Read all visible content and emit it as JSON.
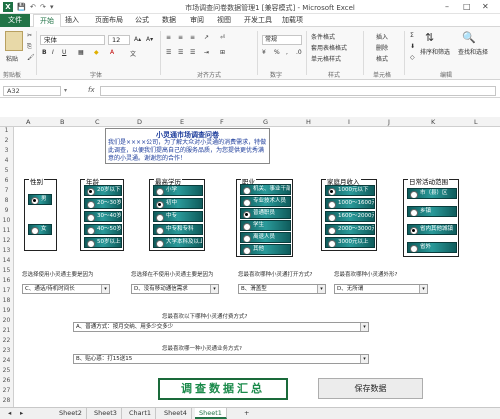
{
  "window": {
    "title": "市场调查问卷数据管理1 [兼容模式] - Microsoft Excel",
    "min": "–",
    "max": "□",
    "close": "✕"
  },
  "ribbon_tabs": [
    "文件",
    "开始",
    "插入",
    "页面布局",
    "公式",
    "数据",
    "审阅",
    "视图",
    "开发工具",
    "加载项"
  ],
  "ribbon": {
    "paste": "粘贴",
    "font_name": "宋体",
    "font_size": "12",
    "number_format": "常规",
    "bold": "B",
    "italic": "I",
    "underline": "U",
    "cond_format": "条件格式",
    "table_format": "套用表格格式",
    "cell_style": "单元格样式",
    "insert": "插入",
    "delete": "删除",
    "format": "格式",
    "sort_filter": "排序和筛选",
    "find_select": "查找和选择",
    "groups": [
      "剪贴板",
      "字体",
      "对齐方式",
      "数字",
      "样式",
      "单元格",
      "编辑"
    ]
  },
  "formula_bar": {
    "name_box": "A32",
    "fx": "fx",
    "value": ""
  },
  "columns": [
    "A",
    "B",
    "C",
    "D",
    "E",
    "F",
    "G",
    "H",
    "I",
    "J",
    "K",
    "L"
  ],
  "rows": [
    "1",
    "2",
    "3",
    "4",
    "5",
    "6",
    "7",
    "8",
    "9",
    "10",
    "11",
    "12",
    "13",
    "14",
    "15",
    "16",
    "17",
    "18",
    "19",
    "20",
    "21",
    "22",
    "23",
    "24",
    "25",
    "26",
    "27",
    "28",
    "29",
    "30",
    "31",
    "32"
  ],
  "survey": {
    "title": "小灵通市场调查问卷",
    "intro": "我们是××××公司，为了解大众对小灵通的消费需求，特做此调查，以便我们提高自己的服务品质，为您提供更优秀满意的小灵通。谢谢您的合作！",
    "panels": [
      {
        "title": "性别",
        "options": [
          "男",
          "女"
        ],
        "selected": 0
      },
      {
        "title": "年龄",
        "options": [
          "20岁以下",
          "20～30岁",
          "30～40岁",
          "40～50岁",
          "50岁以上"
        ],
        "selected": 0
      },
      {
        "title": "最高学历",
        "options": [
          "小学",
          "初中",
          "中专",
          "中专和专科",
          "大学本科及以上"
        ],
        "selected": 1
      },
      {
        "title": "职业",
        "options": [
          "机关、事业干部",
          "专业技术人员",
          "普通职员",
          "学生",
          "离退人员",
          "其他"
        ],
        "selected": 2
      },
      {
        "title": "家庭月收入",
        "options": [
          "1000元以下",
          "1000～1600元",
          "1600～2000元",
          "2000～3000元",
          "3000元以上"
        ],
        "selected": 0
      },
      {
        "title": "日常活动范围",
        "options": [
          "市（县）区",
          "乡镇",
          "省内其他城镇",
          "省外"
        ],
        "selected": 2
      }
    ],
    "questions": [
      {
        "label": "您选择使用小灵通主要是因为",
        "answer": "C、通话/待机时间长"
      },
      {
        "label": "您选择在不使用小灵通主要是因为",
        "answer": "D、没有移动通信需求"
      },
      {
        "label": "您最喜欢哪种小灵通打开方式?",
        "answer": "B、滑盖型"
      },
      {
        "label": "您最喜欢哪种小灵通外形?",
        "answer": "D、无所谓"
      },
      {
        "label": "您最喜欢以下哪种小灵通付费方式?",
        "answer": "A、普通方式：按月交纳、用多少交多少"
      },
      {
        "label": "您最喜欢哪一种小灵通业务方式?",
        "answer": "B、贴心惑：打15送15"
      }
    ],
    "summary_label": "调查数据汇总",
    "save_label": "保存数据"
  },
  "sheet_tabs": [
    "◂",
    "▸",
    "Sheet2",
    "Sheet3",
    "Chart1",
    "Sheet4",
    "Sheet1",
    "+"
  ],
  "active_sheet": "Sheet1"
}
